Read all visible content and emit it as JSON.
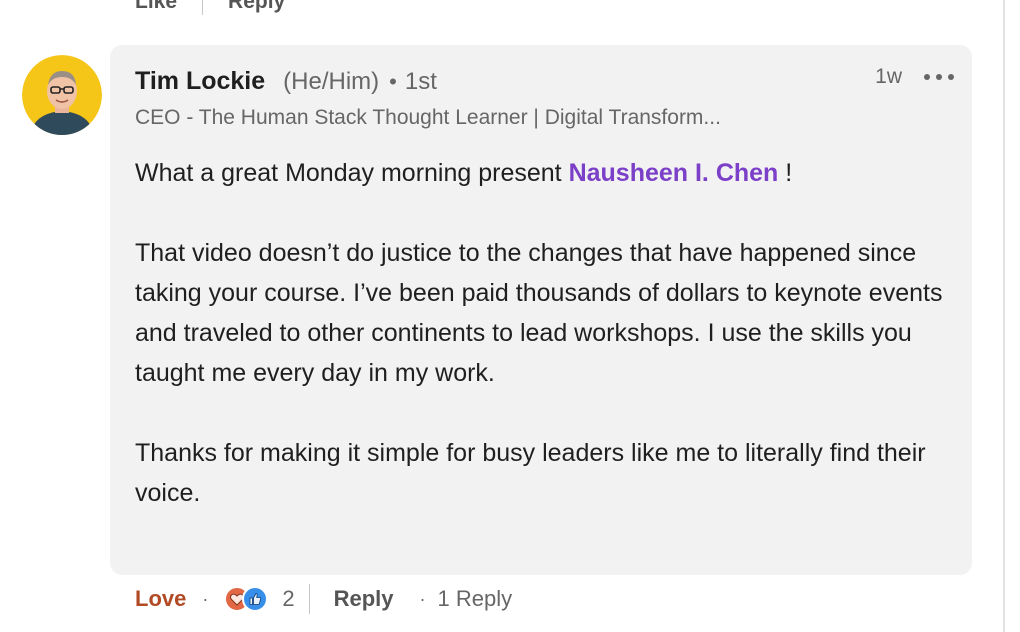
{
  "previous_comment": {
    "like_label": "Like",
    "reply_label": "Reply"
  },
  "comment": {
    "author": "Tim Lockie",
    "pronouns": "(He/Him)",
    "degree": "1st",
    "headline": "CEO - The Human Stack Thought Learner | Digital Transform...",
    "timestamp": "1w",
    "text_before_mention": "What a great Monday morning present ",
    "mention": "Nausheen I. Chen",
    "text_after_mention": " !",
    "paragraph_2": "That video doesn’t do justice to the changes that have happened since taking your course. I’ve been paid thousands of dollars to keynote events and traveled to other continents to lead workshops. I use the skills you taught me every day in my work.",
    "paragraph_3": "Thanks for making it simple for busy leaders like me to literally find their voice."
  },
  "actions": {
    "reaction_label": "Love",
    "reaction_count": "2",
    "reply_label": "Reply",
    "replies_count_label": "1 Reply"
  },
  "icons": {
    "more": "more-horizontal-icon",
    "heart": "love-reaction-icon",
    "like": "like-reaction-icon"
  },
  "colors": {
    "bubble_bg": "#f2f2f2",
    "mention": "#7b3fc8",
    "love": "#b14a25",
    "avatar_bg": "#f5c518"
  }
}
